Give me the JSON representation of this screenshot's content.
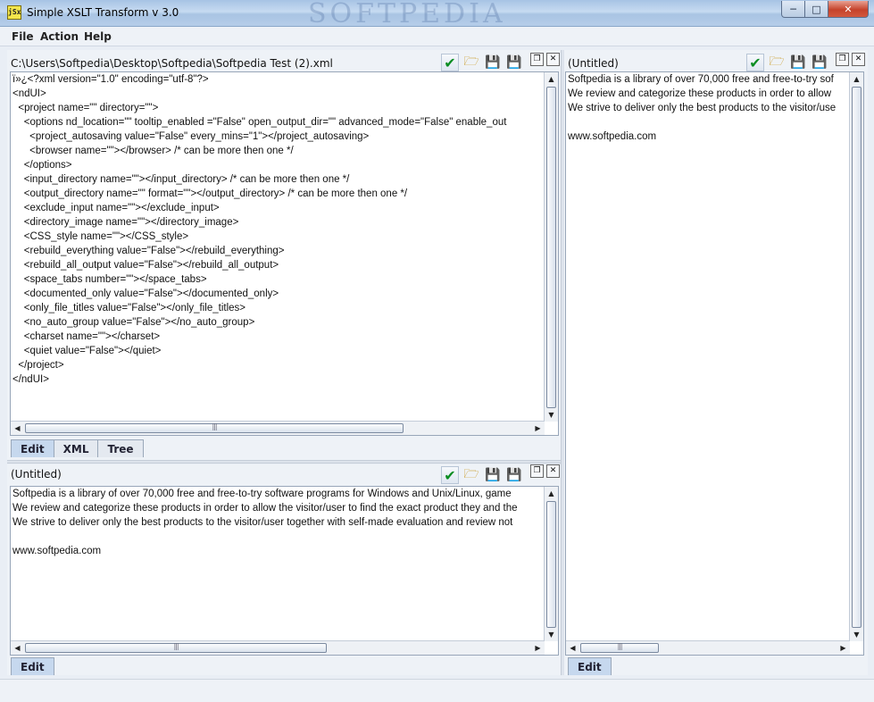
{
  "window": {
    "icon_text": "jSx",
    "title": "Simple XSLT Transform v 3.0",
    "watermark": "SOFTPEDIA"
  },
  "menu": {
    "file": "File",
    "action": "Action",
    "help": "Help"
  },
  "xml_panel": {
    "title": "C:\\Users\\Softpedia\\Desktop\\Softpedia\\Softpedia Test (2).xml",
    "lines": [
      "ï»¿<?xml version=\"1.0\" encoding=\"utf-8\"?>",
      "<ndUI>",
      "  <project name=\"\" directory=\"\">",
      "    <options nd_location=\"\" tooltip_enabled =\"False\" open_output_dir=\"\" advanced_mode=\"False\" enable_out",
      "      <project_autosaving value=\"False\" every_mins=\"1\"></project_autosaving>",
      "      <browser name=\"\"></browser> /* can be more then one */",
      "    </options>",
      "    <input_directory name=\"\"></input_directory> /* can be more then one */",
      "    <output_directory name=\"\" format=\"\"></output_directory> /* can be more then one */",
      "    <exclude_input name=\"\"></exclude_input>",
      "    <directory_image name=\"\"></directory_image>",
      "    <CSS_style name=\"\"></CSS_style>",
      "    <rebuild_everything value=\"False\"></rebuild_everything>",
      "    <rebuild_all_output value=\"False\"></rebuild_all_output>",
      "    <space_tabs number=\"\"></space_tabs>",
      "    <documented_only value=\"False\"></documented_only>",
      "    <only_file_titles value=\"False\"></only_file_titles>",
      "    <no_auto_group value=\"False\"></no_auto_group>",
      "    <charset name=\"\"></charset>",
      "    <quiet value=\"False\"></quiet>",
      "  </project>",
      "</ndUI>"
    ],
    "tabs": [
      "Edit",
      "XML",
      "Tree"
    ]
  },
  "xsl_panel": {
    "title": "(Untitled)",
    "lines": [
      "Softpedia is a library of over 70,000 free and free-to-try software programs for Windows and Unix/Linux, game",
      "We review and categorize these products in order to allow the visitor/user to find the exact product they and the",
      "We strive to deliver only the best products to the visitor/user together with self-made evaluation and review not",
      "",
      "www.softpedia.com"
    ],
    "tabs": [
      "Edit"
    ]
  },
  "output_panel": {
    "title": "(Untitled)",
    "lines": [
      "Softpedia is a library of over 70,000 free and free-to-try sof",
      "We review and categorize these products in order to allow",
      "We strive to deliver only the best products to the visitor/use",
      "",
      "www.softpedia.com"
    ],
    "tabs": [
      "Edit"
    ]
  },
  "icons": {
    "check": "check-icon",
    "open": "open-folder-icon",
    "save": "save-icon",
    "save_as": "save-as-icon",
    "restore": "restore-icon",
    "close": "close-icon"
  },
  "colors": {
    "check_green": "#0b8d22",
    "tab_active": "#c6d8ee",
    "close_red": "#c5432b"
  }
}
